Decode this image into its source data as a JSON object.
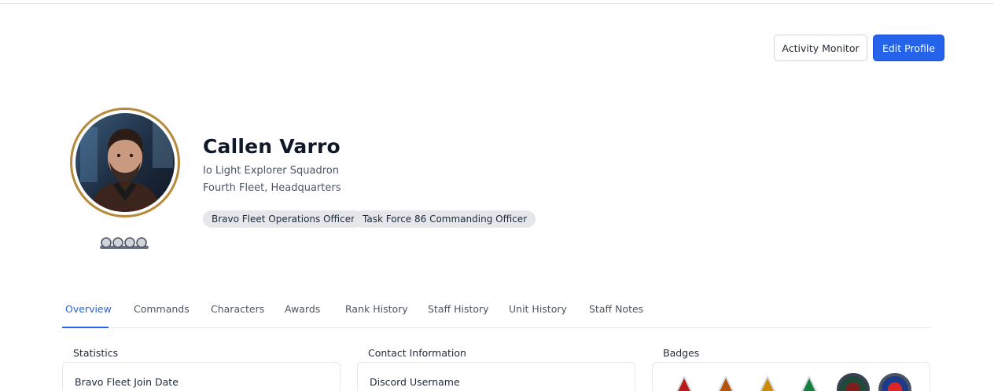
{
  "header": {
    "activity_monitor_label": "Activity Monitor",
    "edit_profile_label": "Edit Profile"
  },
  "profile": {
    "name": "Callen Varro",
    "unit": "Io Light Explorer Squadron",
    "location": "Fourth Fleet, Headquarters",
    "positions": [
      "Bravo Fleet Operations Officer",
      "Task Force 86 Commanding Officer"
    ]
  },
  "tabs": [
    {
      "label": "Overview",
      "active": true
    },
    {
      "label": "Commands"
    },
    {
      "label": "Characters"
    },
    {
      "label": "Awards"
    },
    {
      "label": "Rank History"
    },
    {
      "label": "Staff History"
    },
    {
      "label": "Unit History"
    },
    {
      "label": "Staff Notes"
    }
  ],
  "sections": {
    "statistics": {
      "title": "Statistics",
      "first_row_label": "Bravo Fleet Join Date"
    },
    "contact": {
      "title": "Contact Information",
      "first_row_label": "Discord Username"
    },
    "badges": {
      "title": "Badges"
    }
  },
  "colors": {
    "primary": "#2563eb",
    "avatar_ring": "#b7893a",
    "pill_bg": "#e5e7eb",
    "badge_red": "#b91c1c",
    "badge_orange": "#b45309",
    "badge_yellow": "#ca8a04",
    "badge_green": "#15803d"
  }
}
